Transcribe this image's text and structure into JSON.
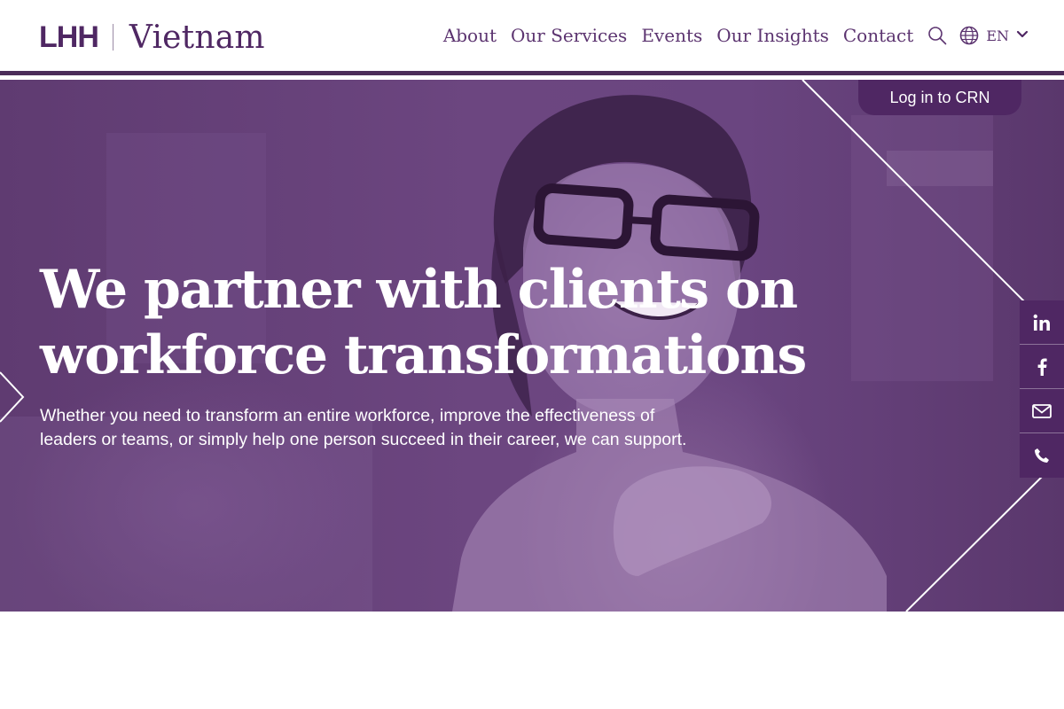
{
  "brand": {
    "mark": "LHH",
    "country": "Vietnam"
  },
  "nav": {
    "items": [
      "About",
      "Our Services",
      "Events",
      "Our Insights",
      "Contact"
    ],
    "language": "EN"
  },
  "hero": {
    "login_label": "Log in to CRN",
    "title_line1": "We partner with clients on",
    "title_line2": "workforce transformations",
    "subtitle_line1": "Whether you need to transform an entire workforce, improve the effectiveness of",
    "subtitle_line2": "leaders or teams, or simply help one person succeed in their career, we can support."
  },
  "social": [
    "linkedin-icon",
    "facebook-icon",
    "mail-icon",
    "phone-icon"
  ],
  "colors": {
    "brand_purple": "#4f2763",
    "nav_text": "#5c3470",
    "hero_overlay": "#6a4580"
  }
}
